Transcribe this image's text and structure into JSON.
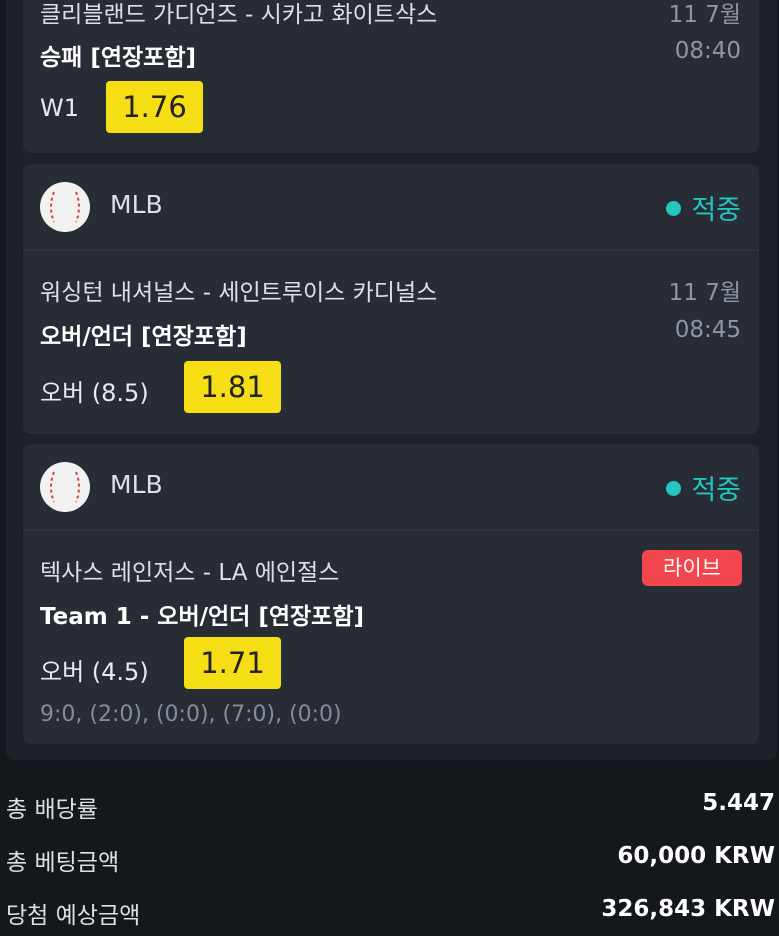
{
  "bets": [
    {
      "teams": "클리블랜드 가디언즈 - 시카고 화이트삭스",
      "date": "11 7월",
      "market": "승패 [연장포함]",
      "time": "08:40",
      "pick": "W1",
      "odds": "1.76"
    },
    {
      "league": "MLB",
      "league_icon": "baseball-icon",
      "status": "적중",
      "teams": "워싱턴 내셔널스 - 세인트루이스 카디널스",
      "date": "11 7월",
      "market": "오버/언더 [연장포함]",
      "time": "08:45",
      "pick": "오버 (8.5)",
      "odds": "1.81"
    },
    {
      "league": "MLB",
      "league_icon": "baseball-icon",
      "status": "적중",
      "teams": "텍사스 레인저스 - LA 에인절스",
      "badge": "라이브",
      "market": "Team 1 - 오버/언더 [연장포함]",
      "pick": "오버 (4.5)",
      "odds": "1.71",
      "score": "9:0, (2:0), (0:0), (7:0), (0:0)"
    }
  ],
  "summary": {
    "total_odds_label": "총 배당률",
    "total_odds_value": "5.447",
    "total_stake_label": "총 베팅금액",
    "total_stake_value": "60,000 KRW",
    "expected_win_label": "당첨 예상금액",
    "expected_win_value": "326,843 KRW"
  },
  "colors": {
    "status_green": "#21c7c0",
    "odds_yellow": "#f5df14",
    "live_red": "#f2454e",
    "background": "#14171c",
    "card": "#272c35"
  }
}
